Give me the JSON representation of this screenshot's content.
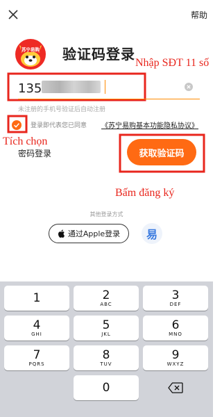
{
  "topbar": {
    "help_label": "帮助"
  },
  "logo_text": "苏宁易购",
  "page_title": "验证码登录",
  "annotations": {
    "phone": "Nhập SĐT 11 số",
    "check": "Tích chọn",
    "register": "Bấm đăng ký"
  },
  "phone": {
    "prefix": "135",
    "hint": "未注册的手机号验证后自动注册"
  },
  "agreement": {
    "text": "登录即代表您已同意",
    "link": "《苏宁易购基本功能隐私协议》",
    "checked": true
  },
  "password_login_label": "密码登录",
  "get_code_label": "获取验证码",
  "other_login": {
    "label": "其他登录方式",
    "apple_label": "通过Apple登录",
    "yi_label": "易"
  },
  "keyboard": {
    "keys": [
      {
        "num": "1",
        "sub": ""
      },
      {
        "num": "2",
        "sub": "ABC"
      },
      {
        "num": "3",
        "sub": "DEF"
      },
      {
        "num": "4",
        "sub": "GHI"
      },
      {
        "num": "5",
        "sub": "JKL"
      },
      {
        "num": "6",
        "sub": "MNO"
      },
      {
        "num": "7",
        "sub": "PQRS"
      },
      {
        "num": "8",
        "sub": "TUV"
      },
      {
        "num": "9",
        "sub": "WXYZ"
      },
      {
        "num": "0",
        "sub": ""
      }
    ]
  },
  "colors": {
    "accent": "#ff6a13",
    "annotation_red": "#e8261d",
    "input_underline": "#ff8a00"
  }
}
